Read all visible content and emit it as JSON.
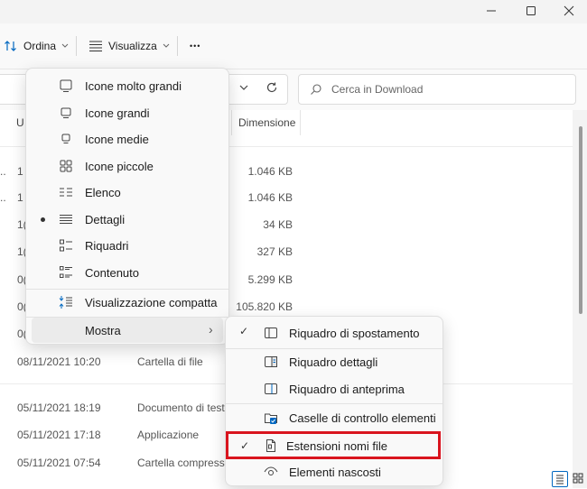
{
  "toolbar": {
    "sort_label": "Ordina",
    "view_label": "Visualizza",
    "more_label": "•••"
  },
  "search": {
    "placeholder": "Cerca in Download"
  },
  "columns": {
    "partial_first": "U",
    "size": "Dimensione"
  },
  "rows": [
    {
      "lead": "..",
      "col1": "1",
      "size": "1.046 KB"
    },
    {
      "lead": "..",
      "col1": "1",
      "size": "1.046 KB"
    },
    {
      "lead": "",
      "col1": "1(",
      "size": "34 KB"
    },
    {
      "lead": "",
      "col1": "1(",
      "size": "327 KB"
    },
    {
      "lead": "",
      "col1": "0(",
      "size": "5.299 KB"
    },
    {
      "lead": "",
      "col1": "0(",
      "size": "105.820 KB"
    },
    {
      "lead": "",
      "col1": "0(",
      "size": ""
    },
    {
      "lead": "",
      "col1": "08/11/2021 10:20",
      "type": "Cartella di file",
      "size": ""
    },
    {
      "lead": "",
      "col1": "05/11/2021 18:19",
      "type": "Documento di testo",
      "size": ""
    },
    {
      "lead": "",
      "col1": "05/11/2021 17:18",
      "type": "Applicazione",
      "size": ""
    },
    {
      "lead": "",
      "col1": "05/11/2021 07:54",
      "type": "Cartella compressa",
      "size": ""
    }
  ],
  "view_menu": {
    "items": [
      {
        "label": "Icone molto grandi",
        "icon": "monitor-large-icon"
      },
      {
        "label": "Icone grandi",
        "icon": "monitor-icon"
      },
      {
        "label": "Icone medie",
        "icon": "monitor-small-icon"
      },
      {
        "label": "Icone piccole",
        "icon": "grid-icon"
      },
      {
        "label": "Elenco",
        "icon": "list-icon"
      },
      {
        "label": "Dettagli",
        "icon": "details-icon",
        "selected": true
      },
      {
        "label": "Riquadri",
        "icon": "tiles-icon"
      },
      {
        "label": "Contenuto",
        "icon": "content-icon"
      },
      {
        "label": "Visualizzazione compatta",
        "icon": "compact-icon"
      },
      {
        "label": "Mostra",
        "icon": "",
        "submenu_arrow": "›"
      }
    ]
  },
  "show_menu": {
    "items": [
      {
        "label": "Riquadro di spostamento",
        "icon": "navigation-pane-icon",
        "checked": true
      },
      {
        "label": "Riquadro dettagli",
        "icon": "details-pane-icon",
        "checked": false
      },
      {
        "label": "Riquadro di anteprima",
        "icon": "preview-pane-icon",
        "checked": false
      },
      {
        "label": "Caselle di controllo elementi",
        "icon": "item-checkbox-icon",
        "checked": false
      },
      {
        "label": "Estensioni nomi file",
        "icon": "file-extension-icon",
        "checked": true,
        "highlighted": true
      },
      {
        "label": "Elementi nascosti",
        "icon": "eye-icon",
        "checked": false
      }
    ],
    "check_mark": "✓"
  },
  "colors": {
    "highlight_box": "#d9141e",
    "accent": "#0067c0"
  }
}
